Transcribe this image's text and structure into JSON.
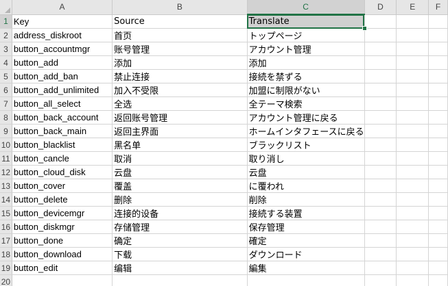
{
  "columns": [
    "A",
    "B",
    "C",
    "D",
    "E",
    "F"
  ],
  "rows": [
    {
      "n": "1",
      "a": "Key",
      "b": "Source",
      "c": "Translate"
    },
    {
      "n": "2",
      "a": "address_diskroot",
      "b": "首页",
      "c": "トップページ"
    },
    {
      "n": "3",
      "a": "button_accountmgr",
      "b": "账号管理",
      "c": "アカウント管理"
    },
    {
      "n": "4",
      "a": "button_add",
      "b": "添加",
      "c": "添加"
    },
    {
      "n": "5",
      "a": "button_add_ban",
      "b": "禁止连接",
      "c": "接続を禁ずる"
    },
    {
      "n": "6",
      "a": "button_add_unlimited",
      "b": "加入不受限",
      "c": "加盟に制限がない"
    },
    {
      "n": "7",
      "a": "button_all_select",
      "b": "全选",
      "c": "全テーマ検索"
    },
    {
      "n": "8",
      "a": "button_back_account",
      "b": "返回账号管理",
      "c": "アカウント管理に戻る"
    },
    {
      "n": "9",
      "a": "button_back_main",
      "b": "返回主界面",
      "c": "ホームインタフェースに戻る"
    },
    {
      "n": "10",
      "a": "button_blacklist",
      "b": "黑名单",
      "c": "ブラックリスト"
    },
    {
      "n": "11",
      "a": "button_cancle",
      "b": "取消",
      "c": "取り消し"
    },
    {
      "n": "12",
      "a": "button_cloud_disk",
      "b": "云盘",
      "c": "云盘"
    },
    {
      "n": "13",
      "a": "button_cover",
      "b": "覆盖",
      "c": "に覆われ"
    },
    {
      "n": "14",
      "a": "button_delete",
      "b": "删除",
      "c": "削除"
    },
    {
      "n": "15",
      "a": "button_devicemgr",
      "b": "连接的设备",
      "c": "接続する装置"
    },
    {
      "n": "16",
      "a": "button_diskmgr",
      "b": "存储管理",
      "c": "保存管理"
    },
    {
      "n": "17",
      "a": "button_done",
      "b": "确定",
      "c": "確定"
    },
    {
      "n": "18",
      "a": "button_download",
      "b": "下载",
      "c": "ダウンロード"
    },
    {
      "n": "19",
      "a": "button_edit",
      "b": "编辑",
      "c": "編集"
    },
    {
      "n": "20",
      "a": "",
      "b": "",
      "c": ""
    }
  ],
  "colors": {
    "accent": "#217346",
    "header_bg": "#e6e6e6",
    "selected_header_bg": "#d2d2d2"
  }
}
